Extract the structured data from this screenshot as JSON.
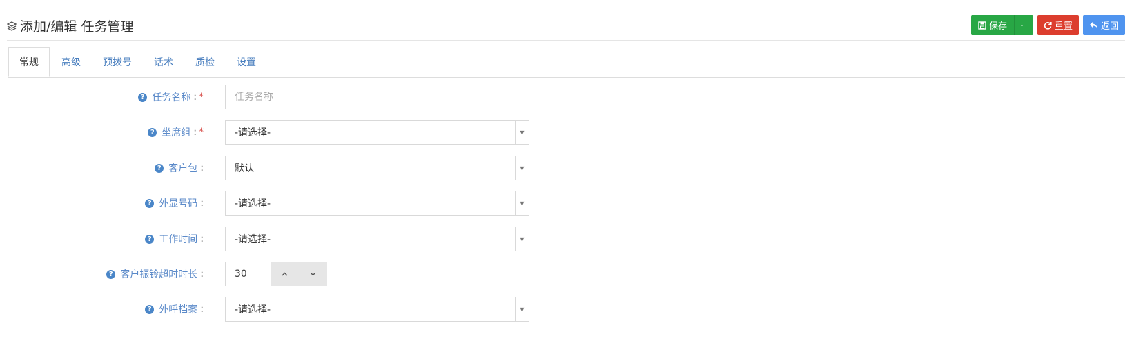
{
  "header": {
    "title": "添加/编辑 任务管理",
    "buttons": {
      "save": "保存",
      "reset": "重置",
      "back": "返回"
    }
  },
  "tabs": [
    {
      "label": "常规",
      "active": true
    },
    {
      "label": "高级"
    },
    {
      "label": "预拨号"
    },
    {
      "label": "话术"
    },
    {
      "label": "质检"
    },
    {
      "label": "设置"
    }
  ],
  "form": {
    "task_name": {
      "label": "任务名称",
      "placeholder": "任务名称",
      "required": "*"
    },
    "agent_group": {
      "label": "坐席组",
      "value": "-请选择-",
      "required": "*"
    },
    "customer_pack": {
      "label": "客户包",
      "value": "默认"
    },
    "display_number": {
      "label": "外显号码",
      "value": "-请选择-"
    },
    "work_time": {
      "label": "工作时间",
      "value": "-请选择-"
    },
    "ring_timeout": {
      "label": "客户振铃超时时长",
      "value": "30"
    },
    "call_profile": {
      "label": "外呼档案",
      "value": "-请选择-"
    },
    "colon": ":"
  },
  "colors": {
    "green": "#28a745",
    "red": "#dc3d2e",
    "blue": "#4f94ef",
    "link": "#4a7fbf"
  }
}
